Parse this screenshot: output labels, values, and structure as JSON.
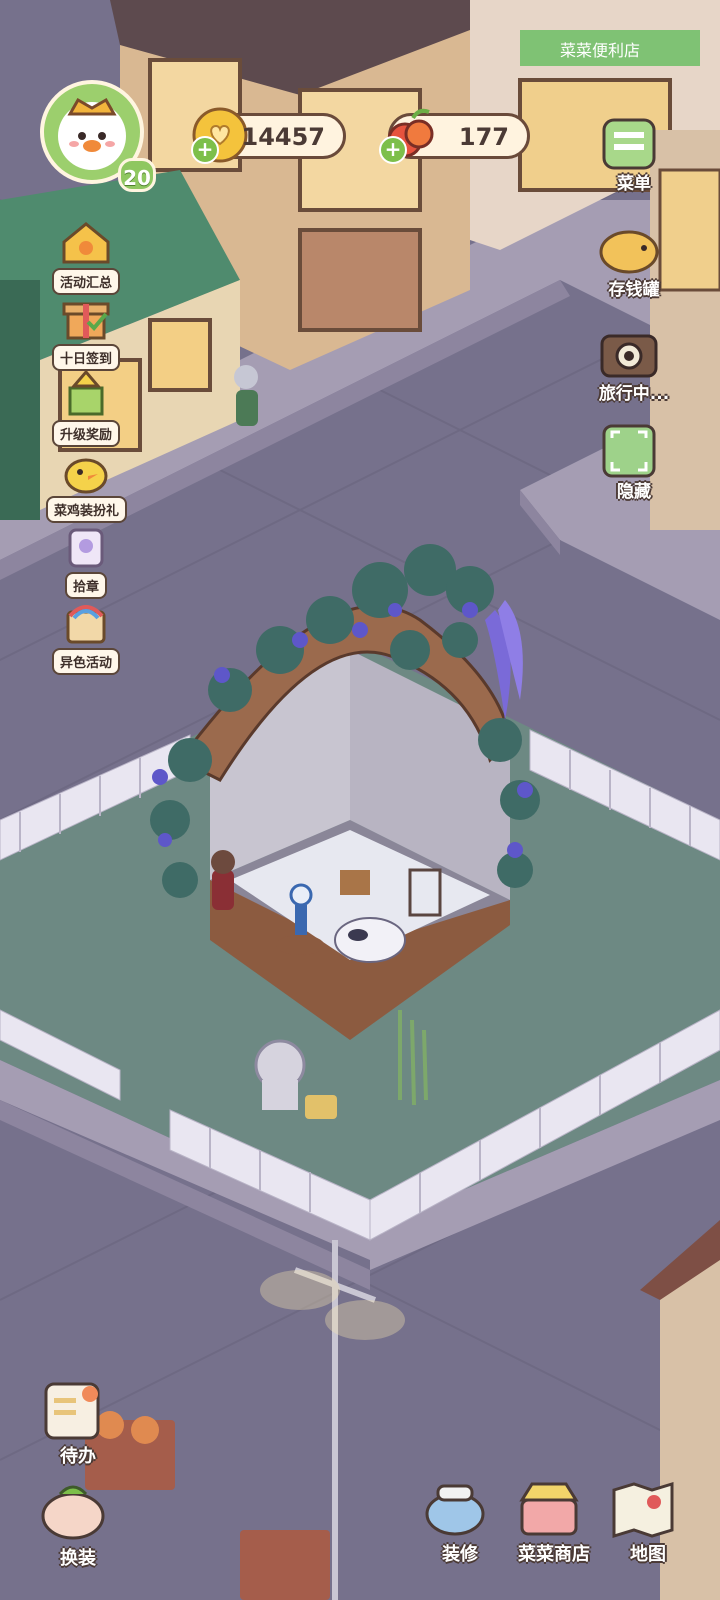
{
  "player": {
    "level": "20"
  },
  "currency": {
    "coins": "14457",
    "food": "177",
    "add_symbol": "+"
  },
  "events": [
    {
      "label": "活动汇总",
      "icon": "house-star-icon"
    },
    {
      "label": "十日签到",
      "icon": "gift-box-icon"
    },
    {
      "label": "升级奖励",
      "icon": "level-up-icon"
    },
    {
      "label": "菜鸡装扮礼",
      "icon": "chick-costume-icon"
    },
    {
      "label": "拾章",
      "icon": "stamp-bag-icon"
    },
    {
      "label": "异色活动",
      "icon": "rainbow-book-icon"
    }
  ],
  "right_menu": [
    {
      "label": "菜单",
      "icon": "menu-board-icon"
    },
    {
      "label": "存钱罐",
      "icon": "piggy-bank-icon"
    },
    {
      "label": "旅行中...",
      "icon": "camera-icon"
    },
    {
      "label": "隐藏",
      "icon": "hide-frame-icon"
    }
  ],
  "bottom_menu": [
    {
      "label": "待办",
      "icon": "todo-board-icon"
    },
    {
      "label": "换装",
      "icon": "outfit-icon"
    },
    {
      "label": "装修",
      "icon": "decorate-icon"
    },
    {
      "label": "菜菜商店",
      "icon": "shop-icon"
    },
    {
      "label": "地图",
      "icon": "map-icon"
    }
  ],
  "scene": {
    "store_sign": "菜菜便利店",
    "colors": {
      "road": "#76718c",
      "sidewalk": "#a59db3",
      "lawn": "#6d8983",
      "fence": "#e9e6f1",
      "wisteria": "#7a6ad8",
      "leaf": "#3f6b66"
    }
  }
}
